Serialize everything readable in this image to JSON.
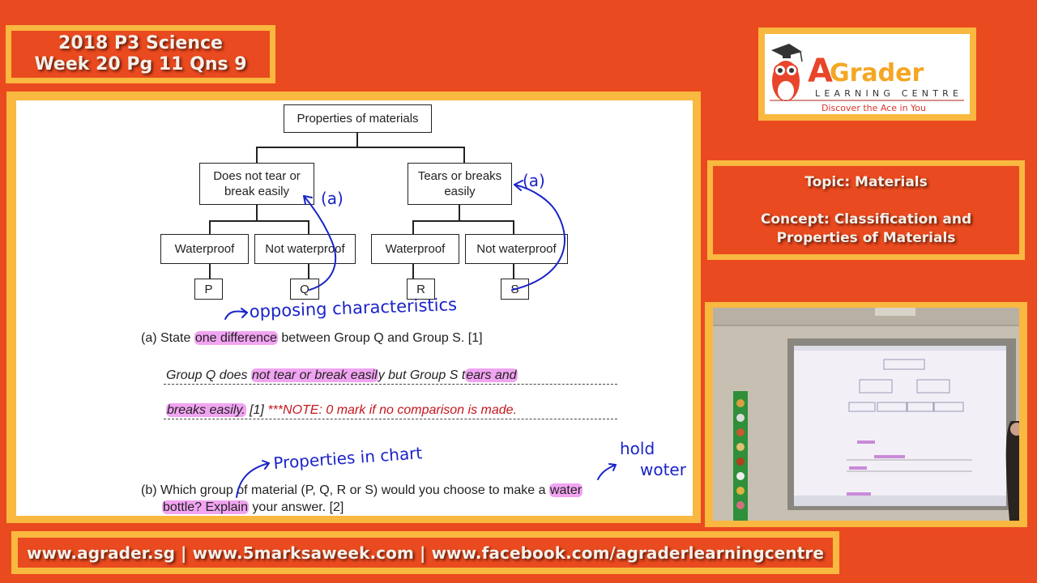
{
  "title": {
    "line1": "2018 P3 Science",
    "line2": "Week 20 Pg 11 Qns 9"
  },
  "logo": {
    "brand_a": "A",
    "brand_rest": "Grader",
    "subtitle": "LEARNING CENTRE",
    "tagline": "Discover the Ace in You",
    "colors": {
      "orange": "#f5a623",
      "red": "#e8452a",
      "tagline": "#d9352b"
    }
  },
  "topic": {
    "topic_line": "Topic: Materials",
    "concept_line1": "Concept: Classification and",
    "concept_line2": "Properties of Materials"
  },
  "worksheet": {
    "root": "Properties of materials",
    "branches": [
      {
        "label_l1": "Does not tear or",
        "label_l2": "break easily",
        "children": [
          {
            "label": "Waterproof",
            "group": "P"
          },
          {
            "label": "Not waterproof",
            "group": "Q"
          }
        ]
      },
      {
        "label_l1": "Tears or breaks",
        "label_l2": "easily",
        "children": [
          {
            "label": "Waterproof",
            "group": "R"
          },
          {
            "label": "Not waterproof",
            "group": "S"
          }
        ]
      }
    ],
    "question_a": {
      "prefix": "(a) State ",
      "highlight": "one difference",
      "suffix": " between Group Q and Group S. [1]"
    },
    "answer_a": {
      "line1_p1": "Group Q does ",
      "line1_hl1": "not tear or break easil",
      "line1_p2": "y but Group S t",
      "line1_hl2": "ears and",
      "line2_hl": "breaks easily.",
      "line2_mark": " [1] ",
      "line2_note": "***NOTE: 0 mark if no comparison is made."
    },
    "question_b": {
      "line1_prefix": "(b) Which group of material (P, Q, R or S) would you choose to make a ",
      "line1_hl": "water",
      "line2_hl": "bottle? Explain",
      "line2_suffix": " your answer. [2]"
    },
    "annotations": {
      "a_left": "(a)",
      "a_right": "(a)",
      "opposing": "opposing characteristics",
      "properties": "Properties in chart",
      "hold": "hold",
      "water": "woter"
    }
  },
  "footer": {
    "links": "www.agrader.sg | www.5marksaweek.com | www.facebook.com/agraderlearningcentre"
  }
}
